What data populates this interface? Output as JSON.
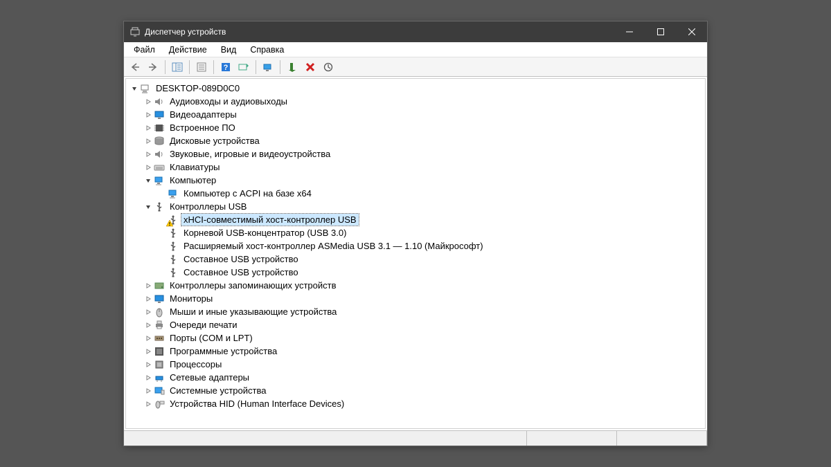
{
  "window": {
    "title": "Диспетчер устройств"
  },
  "menu": {
    "file": "Файл",
    "action": "Действие",
    "view": "Вид",
    "help": "Справка"
  },
  "tree": {
    "root": "DESKTOP-089D0C0",
    "audio": "Аудиовходы и аудиовыходы",
    "video": "Видеоадаптеры",
    "firmware": "Встроенное ПО",
    "disk": "Дисковые устройства",
    "sound": "Звуковые, игровые и видеоустройства",
    "keyboards": "Клавиатуры",
    "computer": "Компьютер",
    "computer_child": "Компьютер с ACPI на базе x64",
    "usb_controllers": "Контроллеры USB",
    "usb_xhci": "xHCI-совместимый хост-контроллер USB",
    "usb_root_hub": "Корневой USB-концентратор (USB 3.0)",
    "usb_asmedia": "Расширяемый хост-контроллер ASMedia USB 3.1 — 1.10 (Майкрософт)",
    "usb_composite1": "Составное USB устройство",
    "usb_composite2": "Составное USB устройство",
    "storage": "Контроллеры запоминающих устройств",
    "monitors": "Мониторы",
    "mice": "Мыши и иные указывающие устройства",
    "print_queues": "Очереди печати",
    "ports": "Порты (COM и LPT)",
    "software": "Программные устройства",
    "processors": "Процессоры",
    "network": "Сетевые адаптеры",
    "system": "Системные устройства",
    "hid": "Устройства HID (Human Interface Devices)"
  }
}
